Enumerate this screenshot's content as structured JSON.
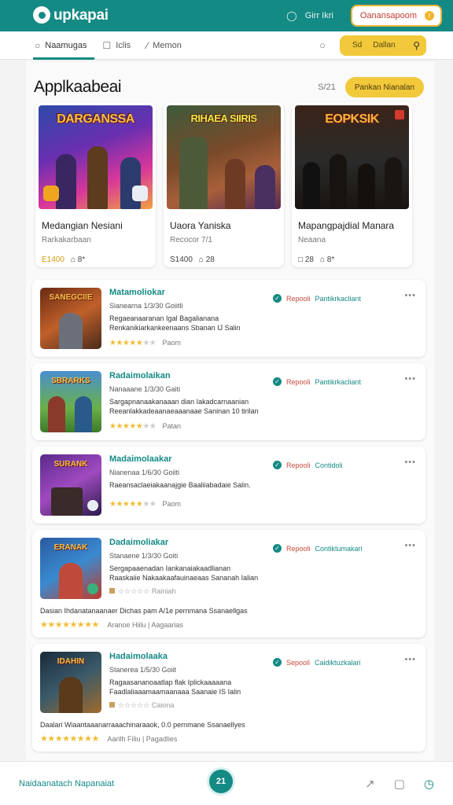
{
  "header": {
    "logo": "upkapai",
    "link": "Girr Ikri",
    "button": "Oanansapoom"
  },
  "nav": {
    "tabs": [
      {
        "label": "Naamugas"
      },
      {
        "label": "Iclis"
      },
      {
        "label": "Memon"
      }
    ],
    "pill_label": "Sd",
    "pill_text": "Dallan"
  },
  "section": {
    "title": "Applkaabeai",
    "count": "S/21",
    "button": "Pankan Nianalan"
  },
  "featured": [
    {
      "art_title": "DARGANSSA",
      "name": "Medangian Nesiani",
      "sub": "Rarkakarbaan",
      "rating": "E1400",
      "meta": "⌂ 8*"
    },
    {
      "art_title": "RIHAEA SIIRIS",
      "name": "Uaora Yaniska",
      "sub": "Recocor 7/1",
      "rating": "S1400",
      "meta": "⌂ 28"
    },
    {
      "art_title": "EOPKSIK",
      "name": "Mapangpajdial Manara",
      "sub": "Neaana",
      "rating": "□ 28",
      "meta": "⌂ 8*"
    }
  ],
  "list": [
    {
      "name": "Matamoliokar",
      "meta": "Sianearna 1/3/30 Goiitli",
      "desc1": "Regaeanaaranan Igal Bagalianana",
      "desc2": "Renkanikiarkankeenaans Sbanan IJ Salin",
      "stars_on": 5,
      "stars_off": 2,
      "rating_label": "Paom",
      "status1": "Repooli",
      "status2": "Pantikrkacliant",
      "thumb_title": "SANEGCIIE"
    },
    {
      "name": "Radaimolaikan",
      "meta": "Nanaaane 1/3/30 Gaiti",
      "desc1": "Sargapnanaakanaaan dian Iakadcarnaanian",
      "desc2": "Reeanlakkadeaanaeaaanaae Saninan 10 tirilan",
      "stars_on": 5,
      "stars_off": 2,
      "rating_label": "Patan",
      "status1": "Repooli",
      "status2": "Pantikrkacliant",
      "thumb_title": "SBRARKS"
    },
    {
      "name": "Madaimolaakar",
      "meta": "Nianenaa 1/6/30 Goiiti",
      "desc1": "Raeansaclaeiakaanajgie Baaliiabadaie Salin.",
      "desc2": "",
      "stars_on": 5,
      "stars_off": 2,
      "rating_label": "Paom",
      "status1": "Repooli",
      "status2": "Contidoli",
      "thumb_title": "SURANK"
    },
    {
      "name": "Dadaimoliakar",
      "meta": "Stanaene 1/3/30 Goiti",
      "desc1": "Sergapaaenadan Iankanaiakaadlianan",
      "desc2": "Raaskaiie Nakaakaafauinaeaas Sananah Ialian",
      "stars_on": 0,
      "stars_off": 5,
      "rating_label": "Rainiah",
      "status1": "Repooli",
      "status2": "Contiktumakari",
      "thumb_title": "ERANAK",
      "extra_text": "Dasian Ihdanatanaanaer Dichas pam A/1e pernmana Ssanaellgas",
      "extra_rating": "Aranoe Hiilu | Aagaarias"
    },
    {
      "name": "Hadaimolaaka",
      "meta": "Stanerea 1/5/30 Goiit",
      "desc1": "Ragaasananoaatlap flak Iplickaaaaana",
      "desc2": "Faadlaliaaamaamaanaaa Saanaie IS Ialin",
      "stars_on": 0,
      "stars_off": 5,
      "rating_label": "Caiona",
      "status1": "Sepooli",
      "status2": "Caidiktuzkalari",
      "thumb_title": "IDAHIN",
      "extra_text": "Daalari Wiaantaaanarraaachinaraaok, 0.0 pernmane Ssanaellyes",
      "extra_rating": "Aarilh Filiu | Pagadlies"
    }
  ],
  "bottom": {
    "text": "Naidaanatach Napanaiat",
    "fab": "21"
  }
}
